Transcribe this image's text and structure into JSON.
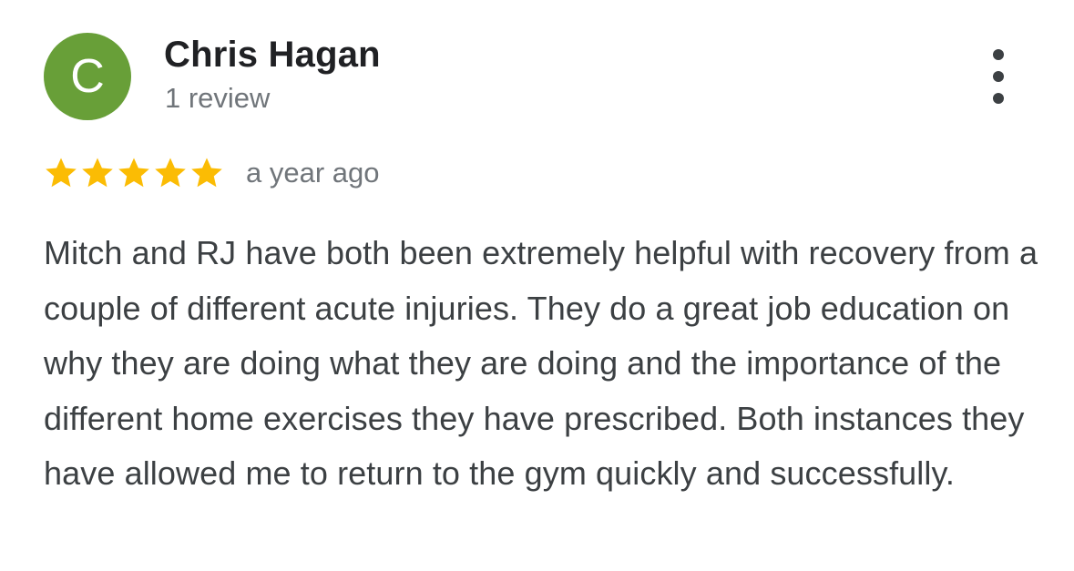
{
  "review": {
    "avatar_initial": "C",
    "avatar_color": "#689f38",
    "author_name": "Chris Hagan",
    "review_count": "1 review",
    "rating": 5,
    "rating_max": 5,
    "star_color": "#fbbc04",
    "timestamp": "a year ago",
    "text": "Mitch and RJ have both been extremely helpful with recovery from a couple of different acute injuries. They do a great job education on why they are doing what they are doing and the importance of the different home exercises they have prescribed. Both instances they have allowed me to return to the gym quickly and successfully.",
    "more_icon": "more-vert-icon"
  }
}
